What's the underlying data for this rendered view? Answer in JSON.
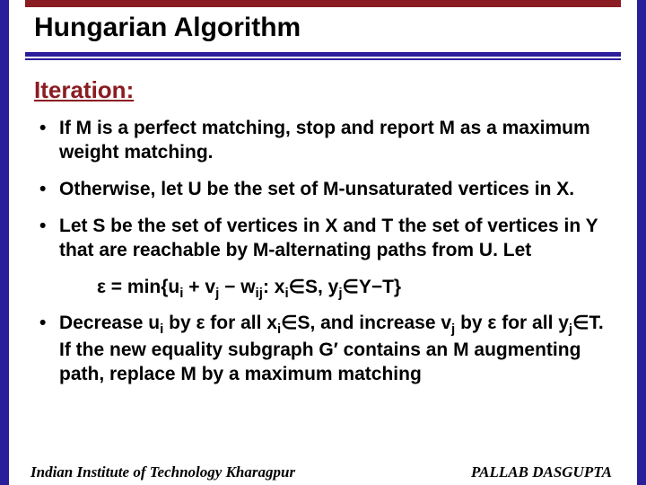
{
  "title": "Hungarian Algorithm",
  "section": "Iteration:",
  "bullets": {
    "b1": "If M is a perfect matching, stop and report M as a maximum weight matching.",
    "b2": "Otherwise, let U be the set of M-unsaturated vertices in X.",
    "b3": "Let S be the set of vertices in X and T the set of vertices in Y that are reachable by M-alternating paths from U. Let"
  },
  "eps": {
    "eq": "ε = min{u",
    "i": "i",
    "plus": " + v",
    "j": "j",
    "minus_w": " − w",
    "ij": "ij",
    "colon_x": ": x",
    "in_s": "∈S, y",
    "in_yt": "∈Y−T}"
  },
  "b4": {
    "t1": "Decrease u",
    "i": "i",
    "t2": " by ε for all x",
    "t3": "∈S, and increase v",
    "j": "j",
    "t4": " by ε for all y",
    "t5": "∈T. If the new equality subgraph G′ contains an M augmenting path, replace M by a maximum matching"
  },
  "footer": {
    "left": "Indian Institute of Technology Kharagpur",
    "right": "PALLAB DASGUPTA"
  }
}
